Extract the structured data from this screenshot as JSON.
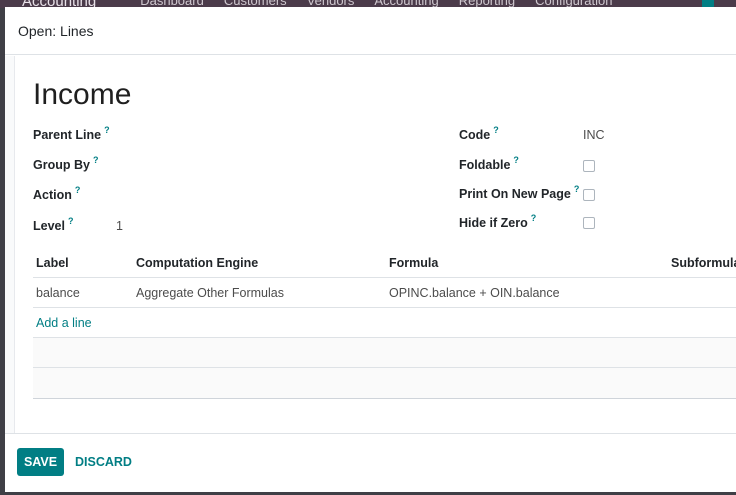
{
  "background_nav": {
    "brand": "Accounting",
    "items": [
      "Dashboard",
      "Customers",
      "Vendors",
      "Accounting",
      "Reporting",
      "Configuration"
    ]
  },
  "dialog": {
    "title": "Open: Lines"
  },
  "record": {
    "name": "Income",
    "help_mark": "?",
    "fields": {
      "parent_line": {
        "label": "Parent Line",
        "value": ""
      },
      "group_by": {
        "label": "Group By",
        "value": ""
      },
      "action": {
        "label": "Action",
        "value": ""
      },
      "level": {
        "label": "Level",
        "value": "1"
      },
      "code": {
        "label": "Code",
        "value": "INC"
      },
      "foldable": {
        "label": "Foldable",
        "checked": false
      },
      "print_on_new_page": {
        "label": "Print On New Page",
        "checked": false
      },
      "hide_if_zero": {
        "label": "Hide if Zero",
        "checked": false
      }
    }
  },
  "expressions_table": {
    "columns": [
      "Label",
      "Computation Engine",
      "Formula",
      "Subformula"
    ],
    "rows": [
      {
        "label": "balance",
        "engine": "Aggregate Other Formulas",
        "formula": "OPINC.balance + OIN.balance",
        "subformula": ""
      }
    ],
    "add_line": "Add a line"
  },
  "footer": {
    "save_label": "SAVE",
    "discard_label": "DISCARD"
  },
  "colors": {
    "primary": "#017e84",
    "nav_bg": "#4b3b4a"
  }
}
